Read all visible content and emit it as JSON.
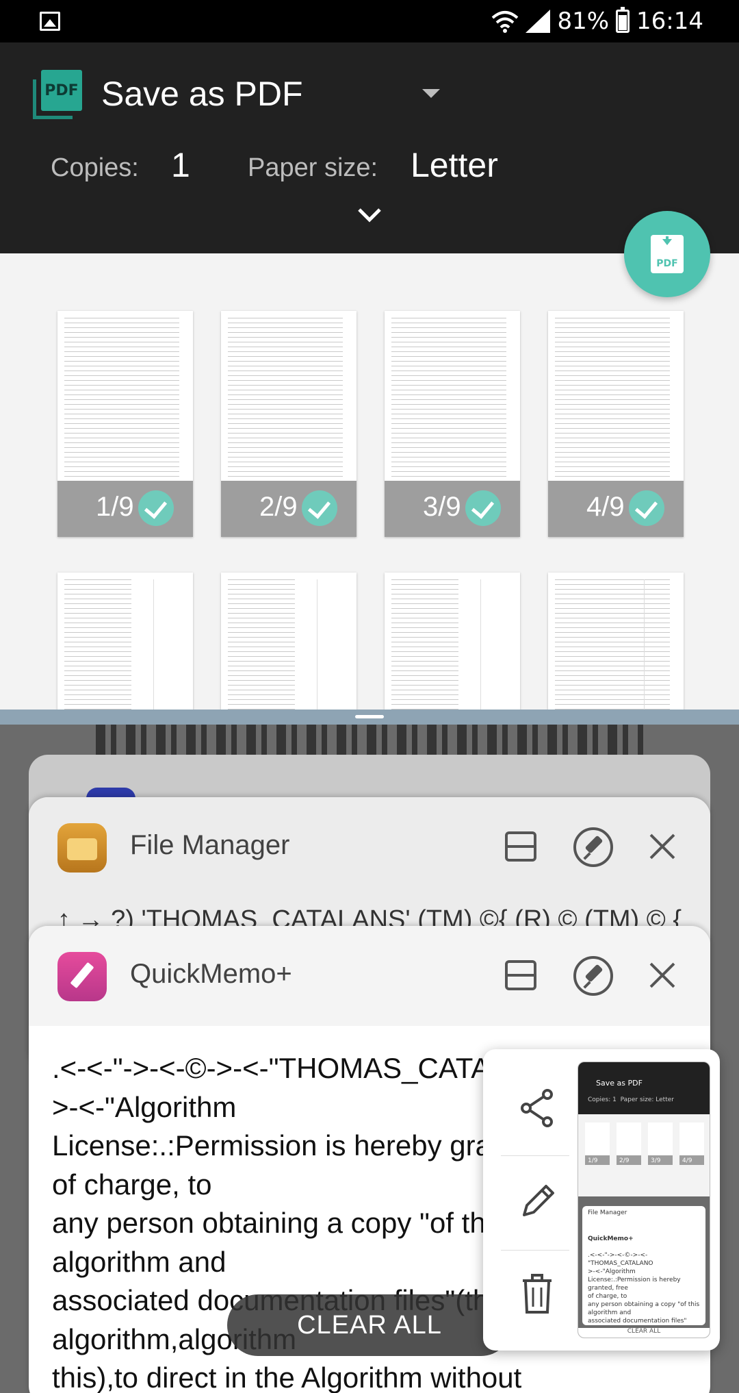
{
  "status_bar": {
    "battery": "81%",
    "time": "16:14",
    "icons": [
      "gallery-icon",
      "wifi-icon",
      "signal-icon",
      "battery-icon"
    ]
  },
  "print_header": {
    "printer_name": "Save as PDF",
    "copies_label": "Copies:",
    "copies_value": "1",
    "paper_label": "Paper size:",
    "paper_value": "Letter",
    "logo_text": "PDF",
    "fab_text": "PDF"
  },
  "preview": {
    "pages": [
      {
        "label": "1/9"
      },
      {
        "label": "2/9"
      },
      {
        "label": "3/9"
      },
      {
        "label": "4/9"
      }
    ],
    "accent": "#4fc3b0"
  },
  "recents": {
    "file_manager": {
      "title": "File Manager",
      "path_text": "↑ → ?) 'THOMAS_CATALANS' (TM) ©{ (R) © (TM) © {"
    },
    "quickmemo": {
      "title": "QuickMemo+",
      "text": ".<-<-\"->-<-©->-<-\"THOMAS_CATALANO\n>-<-\"Algorithm\nLicense:.:Permission is hereby granted, free\nof charge, to\nany person obtaining a copy \"of this\nalgorithm and\nassociated documentation files\"(this\nalgorithm,algorithm\nthis),to direct in the Algorithm without"
    },
    "clear_all": "CLEAR ALL"
  },
  "share_popup": {
    "actions": [
      "share-icon",
      "edit-icon",
      "delete-icon"
    ],
    "mini": {
      "title": "Save as PDF",
      "copies": "Copies: 1",
      "paper": "Paper size: Letter",
      "fm_title": "File Manager",
      "qm_title": "QuickMemo+",
      "memo": ".<-<-\"->-<-©->-<-\"THOMAS_CATALANO\n>-<-\"Algorithm\nLicense:.:Permission is hereby granted, free\nof charge, to\nany person obtaining a copy \"of this\nalgorithm and\nassociated documentation files\"(this\nalgorithm,algorithm\nthis),to direct in the Algorithm without",
      "clear": "CLEAR ALL",
      "pages": [
        "1/9",
        "2/9",
        "3/9",
        "4/9"
      ]
    }
  }
}
